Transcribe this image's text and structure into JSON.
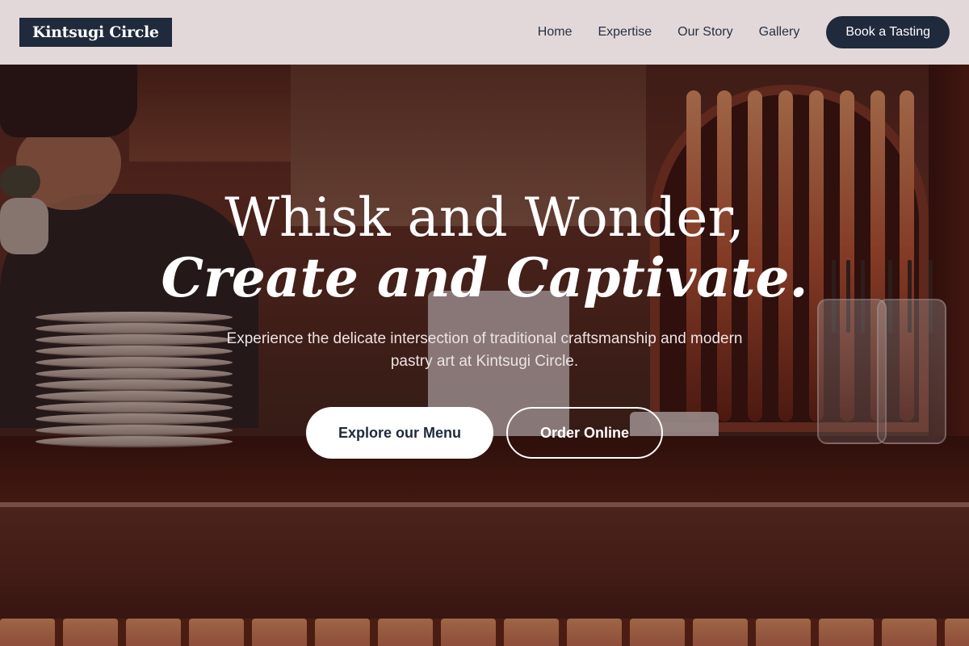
{
  "brand": {
    "name": "Kintsugi Circle"
  },
  "nav": {
    "items": [
      "Home",
      "Expertise",
      "Our Story",
      "Gallery"
    ],
    "cta": "Book a Tasting"
  },
  "hero": {
    "headline_line1": "Whisk and Wonder,",
    "headline_line2": "Create and Captivate.",
    "subtitle": "Experience the delicate intersection of traditional craftsmanship and modern pastry art at Kintsugi Circle.",
    "primary_button": "Explore our Menu",
    "secondary_button": "Order Online",
    "background_image": "pastry-chef-counter-photo"
  },
  "colors": {
    "brand_dark": "#1f2a3c",
    "header_bg": "#eee4e6",
    "text_light": "#ffffff"
  }
}
